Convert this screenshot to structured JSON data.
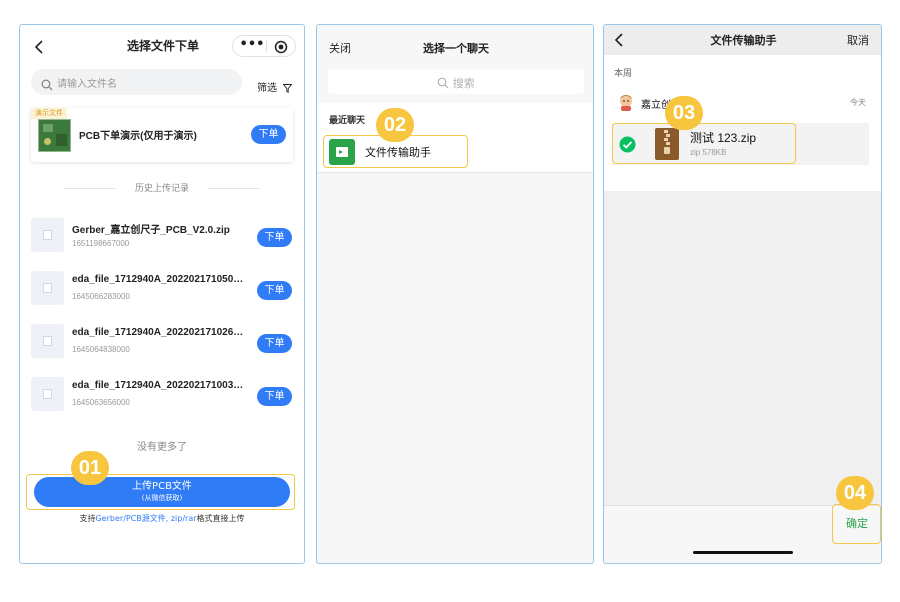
{
  "panel1": {
    "title": "选择文件下单",
    "more_icon": "more-dots-icon",
    "target_icon": "target-icon",
    "search_placeholder": "请输入文件名",
    "filter_label": "筛选",
    "demo": {
      "tag": "演示文件",
      "name": "PCB下单演示(仅用于演示)",
      "button": "下单"
    },
    "history_title": "历史上传记录",
    "files": [
      {
        "name": "Gerber_嘉立创尺子_PCB_V2.0.zip",
        "id": "1651198667000",
        "button": "下单"
      },
      {
        "name": "eda_file_1712940A_2022021710505…",
        "id": "1645066283000",
        "button": "下单"
      },
      {
        "name": "eda_file_1712940A_2022021710263…",
        "id": "1645064838000",
        "button": "下单"
      },
      {
        "name": "eda_file_1712940A_2022021710030…",
        "id": "1645063656000",
        "button": "下单"
      }
    ],
    "no_more": "没有更多了",
    "upload_button": "上传PCB文件",
    "upload_sub": "(从微信获取)",
    "support_prefix": "支持",
    "support_link": "Gerber/PCB源文件, zip/rar",
    "support_suffix": "格式直接上传"
  },
  "panel2": {
    "close_label": "关闭",
    "title": "选择一个聊天",
    "search_placeholder": "搜索",
    "recent_label": "最近聊天",
    "chat_name": "文件传输助手"
  },
  "panel3": {
    "title": "文件传输助手",
    "cancel_label": "取消",
    "week_label": "本周",
    "sender_name": "嘉立创",
    "time_label": "今天",
    "file_name": "测试 123.zip",
    "file_meta": "zip 578KB",
    "confirm_label": "确定"
  },
  "badges": [
    "01",
    "02",
    "03",
    "04"
  ],
  "colors": {
    "accent": "#2f7cf6",
    "callout": "#f7c53e",
    "wechat_green": "#07c160"
  }
}
